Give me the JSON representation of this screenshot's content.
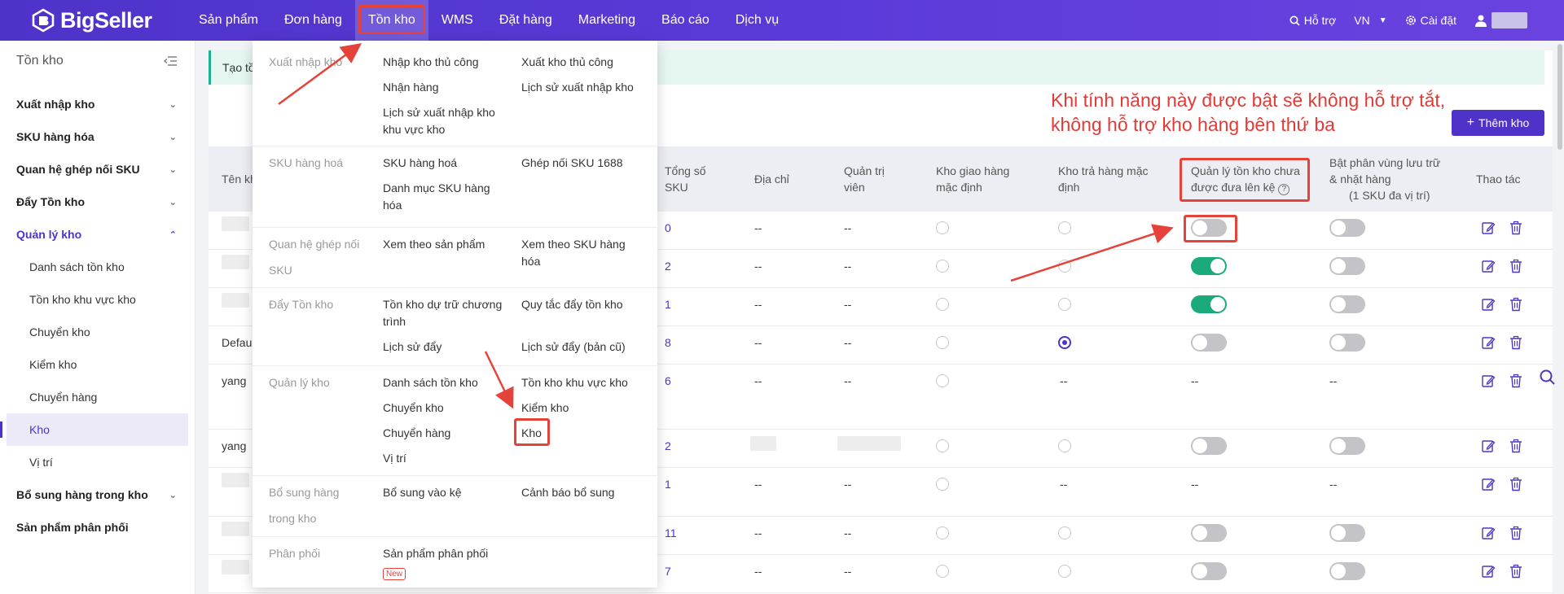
{
  "brand": {
    "name": "BigSeller"
  },
  "nav": {
    "items": [
      "Sản phẩm",
      "Đơn hàng",
      "Tồn kho",
      "WMS",
      "Đặt hàng",
      "Marketing",
      "Báo cáo",
      "Dịch vụ"
    ],
    "active": "Tồn kho"
  },
  "topright": {
    "support": "Hỗ trợ",
    "lang": "VN",
    "settings": "Cài đặt"
  },
  "sidebar": {
    "title": "Tồn kho",
    "groups": [
      {
        "label": "Xuất nhập kho"
      },
      {
        "label": "SKU hàng hóa"
      },
      {
        "label": "Quan hệ ghép nối SKU"
      },
      {
        "label": "Đẩy Tồn kho"
      },
      {
        "label": "Quản lý kho"
      }
    ],
    "subitems": [
      "Danh sách tồn kho",
      "Tồn kho khu vực kho",
      "Chuyển kho",
      "Kiểm kho",
      "Chuyển hàng",
      "Kho",
      "Vị trí"
    ],
    "after": [
      "Bổ sung hàng trong kho",
      "Sản phẩm phân phối"
    ]
  },
  "notice": {
    "text": "Tạo tồ"
  },
  "add_button": "Thêm kho",
  "annotation": {
    "line1": "Khi tính năng này được bật sẽ không hỗ trợ tắt,",
    "line2": "không hỗ trợ kho hàng bên thứ ba"
  },
  "table": {
    "headers": {
      "name": "Tên kh",
      "total_sku_1": "Tổng số",
      "total_sku_2": "SKU",
      "address": "Địa chỉ",
      "admin_1": "Quản trị",
      "admin_2": "viên",
      "default_ship_1": "Kho giao hàng",
      "default_ship_2": "mặc định",
      "default_return_1": "Kho trả hàng mặc",
      "default_return_2": "định",
      "unshelved_1": "Quản lý tồn kho chưa",
      "unshelved_2": "được đưa lên kệ",
      "zone_1": "Bật phân vùng lưu trữ",
      "zone_2": "& nhặt hàng",
      "zone_3": "(1 SKU đa vị trí)",
      "actions": "Thao tác"
    },
    "rows": [
      {
        "name": "",
        "sku": "0",
        "address": "--",
        "admin": "--",
        "ship": "off",
        "ret": "off",
        "unshelved": "off",
        "zone": "off"
      },
      {
        "name": "",
        "sku": "2",
        "address": "--",
        "admin": "--",
        "ship": "off",
        "ret": "off",
        "unshelved": "on",
        "zone": "off"
      },
      {
        "name": "",
        "sku": "1",
        "address": "--",
        "admin": "--",
        "ship": "off",
        "ret": "off",
        "unshelved": "on",
        "zone": "off"
      },
      {
        "name": "Defau",
        "sku": "8",
        "address": "--",
        "admin": "--",
        "ship": "off",
        "ret": "on",
        "unshelved": "off",
        "zone": "off"
      },
      {
        "name": "yang",
        "sku": "6",
        "address": "--",
        "admin": "--",
        "ship": "off",
        "ret": "--",
        "unshelved": "--",
        "zone": "--"
      },
      {
        "name": "yang",
        "sku": "2",
        "address": "",
        "admin": "",
        "ship": "off",
        "ret": "off",
        "unshelved": "off",
        "zone": "off"
      },
      {
        "name": "",
        "sku": "1",
        "address": "--",
        "admin": "--",
        "ship": "off",
        "ret": "--",
        "unshelved": "--",
        "zone": "--"
      },
      {
        "name": "",
        "sku": "11",
        "address": "--",
        "admin": "--",
        "ship": "off",
        "ret": "off",
        "unshelved": "off",
        "zone": "off"
      },
      {
        "name": "",
        "sku": "7",
        "address": "--",
        "admin": "--",
        "ship": "off",
        "ret": "off",
        "unshelved": "off",
        "zone": "off"
      }
    ]
  },
  "dropdown": {
    "sections": [
      {
        "category": "Xuất nhập kho",
        "links": [
          "Nhập kho thủ công",
          "Xuất kho thủ công",
          "Nhận hàng",
          "Lịch sử xuất nhập kho",
          "Lịch sử xuất nhập kho khu vực kho"
        ]
      },
      {
        "category": "SKU hàng hoá",
        "links": [
          "SKU hàng hoá",
          "Ghép nối SKU 1688",
          "Danh mục SKU hàng hóa"
        ]
      },
      {
        "category": "Quan hệ ghép nối SKU",
        "links": [
          "Xem theo sản phẩm",
          "Xem theo SKU hàng hóa"
        ]
      },
      {
        "category": "Đẩy Tồn kho",
        "links": [
          "Tồn kho dự trữ chương trình",
          "Quy tắc đẩy tồn kho",
          "Lịch sử đẩy",
          "Lịch sử đẩy (bản cũ)"
        ]
      },
      {
        "category": "Quản lý kho",
        "links": [
          "Danh sách tồn kho",
          "Tồn kho khu vực kho",
          "Chuyển kho",
          "Kiểm kho",
          "Chuyển hàng",
          "Kho",
          "Vị trí"
        ]
      },
      {
        "category": "Bổ sung hàng trong kho",
        "links": [
          "Bổ sung vào kệ",
          "Cảnh báo bổ sung"
        ]
      },
      {
        "category": "Phân phối",
        "links": [
          "Sản phẩm phân phối"
        ],
        "badge": "New"
      }
    ]
  },
  "colors": {
    "brand": "#4f33c9",
    "toggle_on": "#1aaa7c",
    "highlight": "#e5433a"
  }
}
